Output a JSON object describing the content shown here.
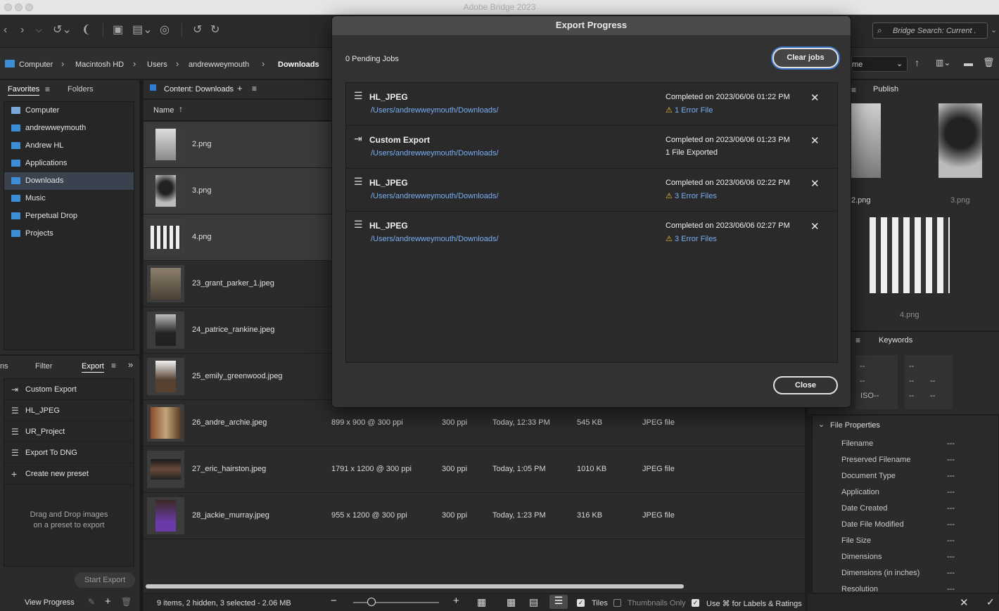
{
  "window": {
    "title": "Adobe Bridge 2023"
  },
  "toolbar": {
    "search_placeholder": "Bridge Search: Current ."
  },
  "path": {
    "crumbs": [
      "Computer",
      "Macintosh HD",
      "Users",
      "andrewweymouth",
      "Downloads"
    ]
  },
  "favorites_panel": {
    "tabs": [
      "Favorites",
      "Folders"
    ],
    "items": [
      {
        "label": "Computer"
      },
      {
        "label": "andrewweymouth"
      },
      {
        "label": "Andrew HL"
      },
      {
        "label": "Applications"
      },
      {
        "label": "Downloads",
        "selected": true
      },
      {
        "label": "Music"
      },
      {
        "label": "Perpetual Drop"
      },
      {
        "label": "Projects"
      }
    ]
  },
  "export_panel": {
    "tabs": [
      "ns",
      "Filter",
      "Export"
    ],
    "items": [
      {
        "label": "Custom Export",
        "icon": "export-icon"
      },
      {
        "label": "HL_JPEG",
        "icon": "list-icon"
      },
      {
        "label": "UR_Project",
        "icon": "list-icon"
      },
      {
        "label": "Export To DNG",
        "icon": "list-icon"
      },
      {
        "label": "Create new preset",
        "icon": "plus-icon"
      }
    ],
    "drop_hint": "Drag and Drop images on a preset to export",
    "start_export": "Start Export",
    "view_progress": "View Progress"
  },
  "content": {
    "tab_label": "Content: Downloads",
    "sort_column": "Name",
    "rows": [
      {
        "name": "2.png",
        "dims": "",
        "ppi": "",
        "date": "",
        "size": "",
        "type": "",
        "selected": true
      },
      {
        "name": "3.png",
        "dims": "",
        "ppi": "",
        "date": "",
        "size": "",
        "type": "",
        "selected": true
      },
      {
        "name": "4.png",
        "dims": "",
        "ppi": "",
        "date": "",
        "size": "",
        "type": "",
        "selected": true
      },
      {
        "name": "23_grant_parker_1.jpeg",
        "dims": "",
        "ppi": "",
        "date": "",
        "size": "",
        "type": ""
      },
      {
        "name": "24_patrice_rankine.jpeg",
        "dims": "",
        "ppi": "",
        "date": "",
        "size": "",
        "type": ""
      },
      {
        "name": "25_emily_greenwood.jpeg",
        "dims": "",
        "ppi": "",
        "date": "",
        "size": "",
        "type": ""
      },
      {
        "name": "26_andre_archie.jpeg",
        "dims": "899 x 900 @ 300 ppi",
        "ppi": "300 ppi",
        "date": "Today, 12:33 PM",
        "size": "545 KB",
        "type": "JPEG file"
      },
      {
        "name": "27_eric_hairston.jpeg",
        "dims": "1791 x 1200 @ 300 ppi",
        "ppi": "300 ppi",
        "date": "Today, 1:05 PM",
        "size": "1010 KB",
        "type": "JPEG file"
      },
      {
        "name": "28_jackie_murray.jpeg",
        "dims": "955 x 1200 @ 300 ppi",
        "ppi": "300 ppi",
        "date": "Today, 1:23 PM",
        "size": "316 KB",
        "type": "JPEG file"
      }
    ],
    "status": "9 items, 2 hidden, 3 selected - 2.06 MB",
    "view_options": {
      "tiles": "Tiles",
      "thumbnails_only": "Thumbnails Only",
      "labels": "Use ⌘ for Labels & Ratings"
    }
  },
  "dialog": {
    "title": "Export Progress",
    "pending": "0 Pending Jobs",
    "clear_label": "Clear jobs",
    "close_label": "Close",
    "jobs": [
      {
        "name": "HL_JPEG",
        "icon": "list-icon",
        "path": "/Users/andrewweymouth/Downloads/",
        "date": "Completed on 2023/06/06 01:22 PM",
        "status": "1 Error File",
        "warning": true
      },
      {
        "name": "Custom Export",
        "icon": "export-icon",
        "path": "/Users/andrewweymouth/Downloads/",
        "date": "Completed on 2023/06/06 01:23 PM",
        "status": "1 File Exported",
        "warning": false
      },
      {
        "name": "HL_JPEG",
        "icon": "list-icon",
        "path": "/Users/andrewweymouth/Downloads/",
        "date": "Completed on 2023/06/06 02:22 PM",
        "status": "3 Error Files",
        "warning": true
      },
      {
        "name": "HL_JPEG",
        "icon": "list-icon",
        "path": "/Users/andrewweymouth/Downloads/",
        "date": "Completed on 2023/06/06 02:27 PM",
        "status": "3 Error Files",
        "warning": true
      }
    ]
  },
  "preview": {
    "sort_value": "me",
    "tab": "Publish",
    "thumbs": [
      "2.png",
      "3.png",
      "4.png"
    ]
  },
  "metadata": {
    "keywords_tab": "Keywords",
    "iso": "ISO--",
    "dash": "--",
    "file_properties_title": "File Properties",
    "fields": [
      {
        "label": "Filename",
        "value": "---"
      },
      {
        "label": "Preserved Filename",
        "value": "---"
      },
      {
        "label": "Document Type",
        "value": "---"
      },
      {
        "label": "Application",
        "value": "---"
      },
      {
        "label": "Date Created",
        "value": "---"
      },
      {
        "label": "Date File Modified",
        "value": "---"
      },
      {
        "label": "File Size",
        "value": "---"
      },
      {
        "label": "Dimensions",
        "value": "---"
      },
      {
        "label": "Dimensions (in inches)",
        "value": "---"
      },
      {
        "label": "Resolution",
        "value": "---"
      }
    ]
  },
  "colors": {
    "accent": "#3c8fd6",
    "link": "#79aef6",
    "warning": "#ecc031",
    "selection": "#3a4250"
  }
}
